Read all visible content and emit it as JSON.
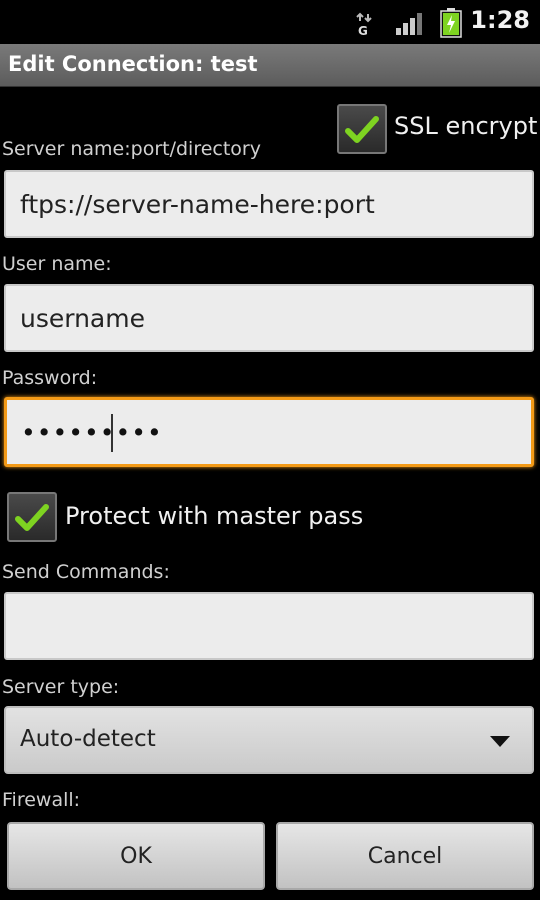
{
  "status_bar": {
    "time": "1:28",
    "network_type": "G",
    "icons": [
      "network-g-icon",
      "signal-icon",
      "battery-charging-icon"
    ]
  },
  "title": "Edit Connection: test",
  "ssl": {
    "label": "SSL encrypt",
    "checked": true
  },
  "server": {
    "label": "Server name:port/directory",
    "value": "ftps://server-name-here:port"
  },
  "username": {
    "label": "User name:",
    "value": "username"
  },
  "password": {
    "label": "Password:",
    "value": "•••••••••"
  },
  "master_pass": {
    "label": "Protect with master pass",
    "checked": true
  },
  "send_commands": {
    "label": "Send Commands:",
    "value": ""
  },
  "server_type": {
    "label": "Server type:",
    "selected": "Auto-detect"
  },
  "firewall": {
    "label": "Firewall:"
  },
  "buttons": {
    "ok": "OK",
    "cancel": "Cancel"
  },
  "colors": {
    "focus_border": "#f39a17",
    "check_green": "#7ed321",
    "title_bar": "#6b6b6b"
  }
}
